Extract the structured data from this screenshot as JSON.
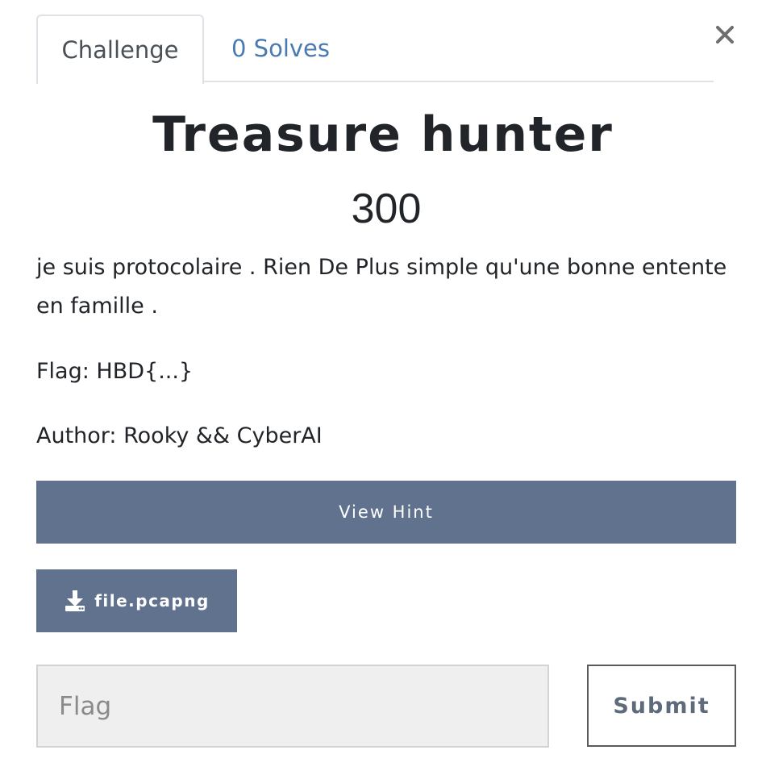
{
  "tabs": [
    {
      "label": "Challenge",
      "active": true
    },
    {
      "label": "0 Solves",
      "active": false
    }
  ],
  "close_icon": "close-icon",
  "challenge": {
    "name": "Treasure hunter",
    "points": "300",
    "description": "je suis protocolaire . Rien De Plus simple qu'une bonne entente en famille .",
    "flag_format": "Flag: HBD{...}",
    "author": "Author: Rooky && CyberAI"
  },
  "actions": {
    "hint_label": "View Hint",
    "file_label": "file.pcapng",
    "file_icon": "download-icon"
  },
  "submission": {
    "flag_placeholder": "Flag",
    "flag_value": "",
    "submit_label": "Submit"
  },
  "colors": {
    "button_bg": "#61728f",
    "link": "#4a7ab0",
    "input_bg": "#efefef"
  }
}
